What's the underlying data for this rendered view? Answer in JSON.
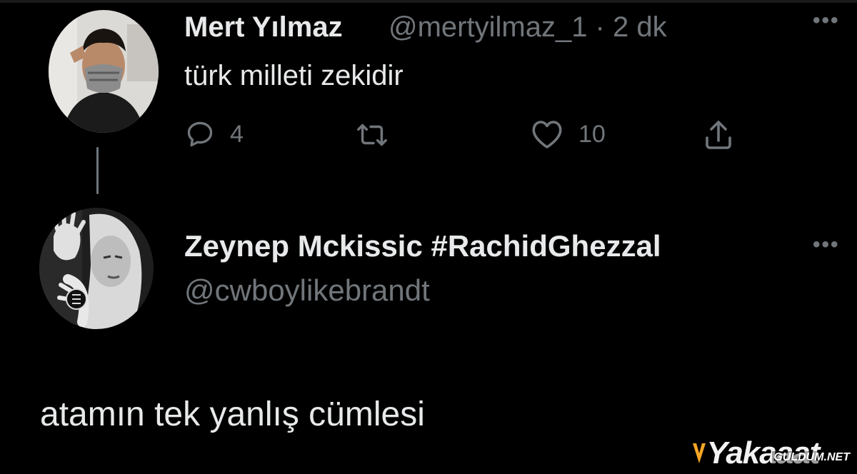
{
  "colors": {
    "background": "#000000",
    "primary_text": "#e7e9ea",
    "secondary_text": "#71767b",
    "thread_line": "#6e767d",
    "watermark_accent": "#f5a623"
  },
  "tweet": {
    "author_name": "Mert Yılmaz",
    "meta": "@mertyilmaz_1 · 2 dk",
    "text": "türk milleti zekidir",
    "reply_count": "4",
    "like_count": "10",
    "icons": [
      "reply-icon",
      "retweet-icon",
      "like-icon",
      "share-icon",
      "more-icon"
    ]
  },
  "reply": {
    "author_name": "Zeynep Mckissic #RachidGhezzal",
    "handle": "@cwboylikebrandt",
    "text": "atamın tek yanlış cümlesi"
  },
  "watermark": {
    "brand": "Yakaaat",
    "site": "GULDUM.NET"
  }
}
